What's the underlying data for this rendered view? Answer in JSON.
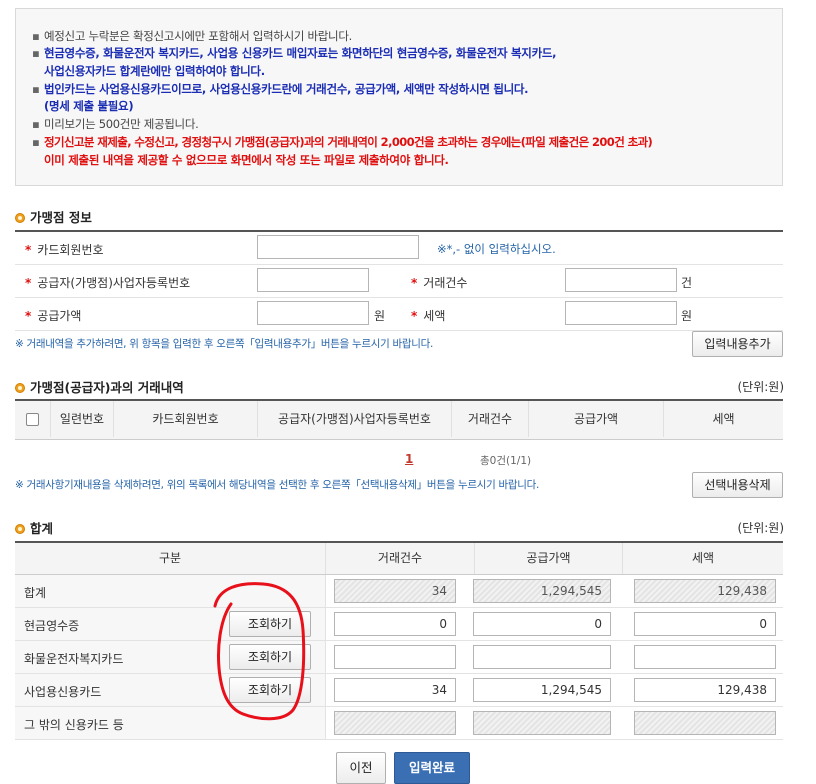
{
  "notice": {
    "lines": [
      "예정신고 누락분은 확정신고시에만 포함해서 입력하시기 바랍니다.",
      "현금영수증, 화물운전자 복지카드, 사업용 신용카드 매입자료는 화면하단의 현금영수증, 화물운전자 복지카드,",
      "사업신용자카드 합계란에만 입력하여야 합니다.",
      "법인카드는 사업용신용카드이므로, 사업용신용카드란에 거래건수, 공급가액, 세액만 작성하시면 됩니다.",
      "(명세 제출 불필요)",
      "미리보기는 500건만 제공됩니다.",
      "정기신고분 재제출, 수정신고, 경정청구시 가맹점(공급자)과의 거래내역이 2,000건을 초과하는 경우에는(파일 제출건은 200건 초과)",
      "이미 제출된 내역을 제공할 수 없으므로 화면에서 작성 또는 파일로 제출하여야 합니다."
    ],
    "bullet": "▪"
  },
  "merchant": {
    "title": "가맹점 정보",
    "card_no_label": "카드회원번호",
    "card_no_hint": "※*,- 없이 입력하십시오.",
    "biz_no_label": "공급자(가맹점)사업자등록번호",
    "tx_count_label": "거래건수",
    "tx_count_suffix": "건",
    "supply_label": "공급가액",
    "supply_suffix": "원",
    "tax_label": "세액",
    "tax_suffix": "원",
    "required_mark": "*",
    "add_note": "※ 거래내역을 추가하려면, 위 항목을 입력한 후 오른쪽「입력내용추가」버튼을 누르시기 바랍니다.",
    "add_button": "입력내용추가"
  },
  "transactions": {
    "title": "가맹점(공급자)과의 거래내역",
    "unit": "(단위:원)",
    "headers": [
      "일련번호",
      "카드회원번호",
      "공급자(가맹점)사업자등록번호",
      "거래건수",
      "공급가액",
      "세액"
    ],
    "page": "1",
    "total": "총0건(1/1)",
    "delete_note": "※ 거래사항기재내용을 삭제하려면, 위의 목록에서 해당내역을 선택한 후 오른쪽「선택내용삭제」버튼을 누르시기 바랍니다.",
    "delete_button": "선택내용삭제"
  },
  "summary": {
    "title": "합계",
    "unit": "(단위:원)",
    "headers": [
      "구분",
      "거래건수",
      "공급가액",
      "세액"
    ],
    "query_button": "조회하기",
    "rows": [
      {
        "name": "합계",
        "count": "34",
        "supply": "1,294,545",
        "tax": "129,438"
      },
      {
        "name": "현금영수증",
        "count": "0",
        "supply": "0",
        "tax": "0"
      },
      {
        "name": "화물운전자복지카드",
        "count": "",
        "supply": "",
        "tax": ""
      },
      {
        "name": "사업용신용카드",
        "count": "34",
        "supply": "1,294,545",
        "tax": "129,438"
      },
      {
        "name": "그 밖의 신용카드 등",
        "count": "",
        "supply": "",
        "tax": ""
      }
    ]
  },
  "footer": {
    "prev_button": "이전",
    "submit_button": "입력완료"
  },
  "colors": {
    "accent_blue": "#3a6fb4",
    "annotation_red": "#e8101a",
    "notice_red": "#e01010",
    "notice_blue": "#1a2db4"
  }
}
